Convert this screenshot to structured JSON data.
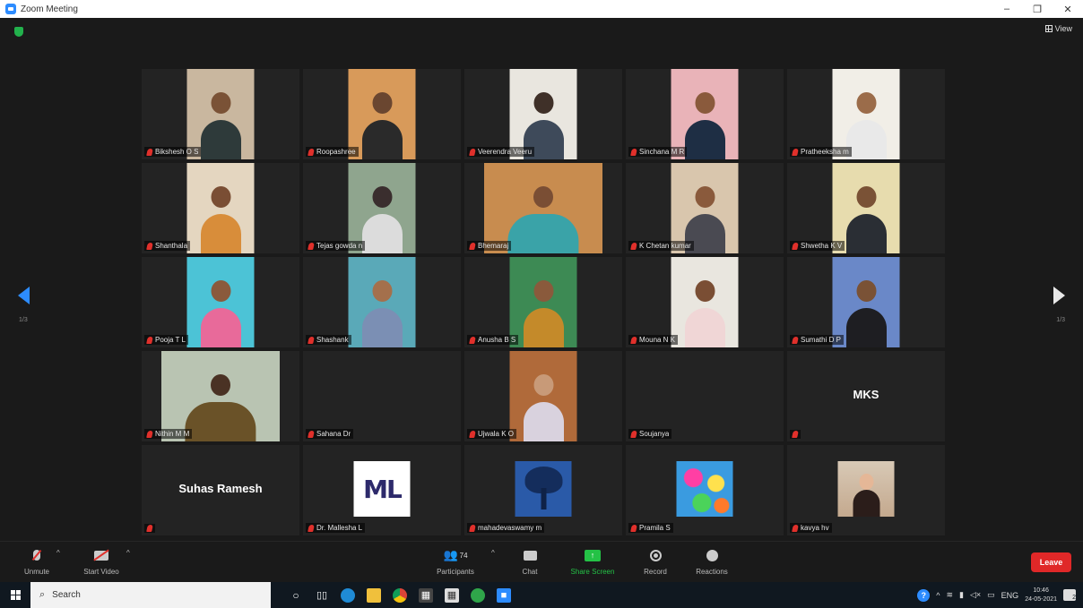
{
  "window": {
    "title": "Zoom Meeting",
    "minimize": "–",
    "maximize": "❐",
    "close": "✕"
  },
  "meeting": {
    "view_label": "View",
    "page_left": "1/3",
    "page_right": "1/3"
  },
  "tiles": [
    {
      "name": "Bikshesh O S",
      "kind": "video",
      "bg": "#c9b79f",
      "skin": "#7a5236",
      "shirt": "#2e3a3a"
    },
    {
      "name": "Roopashree",
      "kind": "video",
      "bg": "#d89a5a",
      "skin": "#6a4630",
      "shirt": "#2a2a2a"
    },
    {
      "name": "Veerendra Veeru",
      "kind": "video",
      "bg": "#e9e6df",
      "skin": "#3f3028",
      "shirt": "#3e4a5a"
    },
    {
      "name": "Sinchana M R",
      "kind": "video",
      "bg": "#e9b3b8",
      "skin": "#8a5a3c",
      "shirt": "#1e2e44"
    },
    {
      "name": "Pratheeksha m",
      "kind": "video",
      "bg": "#f1eee7",
      "skin": "#9b6c4a",
      "shirt": "#e9e9e9"
    },
    {
      "name": "Shanthala",
      "kind": "video",
      "bg": "#e4d6c0",
      "skin": "#7a4e34",
      "shirt": "#d88d3a"
    },
    {
      "name": "Tejas gowda n",
      "kind": "video",
      "bg": "#8fa58e",
      "skin": "#3a2e2e",
      "shirt": "#dcdcdc"
    },
    {
      "name": "Bhemaraj",
      "kind": "video-wide",
      "bg": "#c88c4f",
      "skin": "#7a4e34",
      "shirt": "#3aa3a8"
    },
    {
      "name": "K Chetan kumar",
      "kind": "video",
      "bg": "#d9c6ad",
      "skin": "#8a5a3c",
      "shirt": "#4a4a52"
    },
    {
      "name": "Shwetha K V",
      "kind": "video",
      "bg": "#e7dcae",
      "skin": "#7a5236",
      "shirt": "#2a2e34"
    },
    {
      "name": "Pooja T L",
      "kind": "video",
      "bg": "#4cc3d6",
      "skin": "#8a5a3c",
      "shirt": "#e86a9a"
    },
    {
      "name": "Shashank",
      "kind": "video",
      "bg": "#5aa9b8",
      "skin": "#a4704c",
      "shirt": "#7b8fb4"
    },
    {
      "name": "Anusha B S",
      "kind": "video",
      "bg": "#3d8a54",
      "skin": "#8a5a3c",
      "shirt": "#c48a2a"
    },
    {
      "name": "Mouna N K",
      "kind": "video",
      "bg": "#e9e6df",
      "skin": "#7a4e34",
      "shirt": "#f0d6d6"
    },
    {
      "name": "Sumathi D P",
      "kind": "video",
      "bg": "#6a88c8",
      "skin": "#7a5236",
      "shirt": "#1e1e22"
    },
    {
      "name": "Nithin M M",
      "kind": "video-wide",
      "bg": "#b9c4b2",
      "skin": "#4a3224",
      "shirt": "#6a5228"
    },
    {
      "name": "Sahana Dr",
      "kind": "empty"
    },
    {
      "name": "Ujwala K O",
      "kind": "video",
      "bg": "#b06a3a",
      "skin": "#c89a78",
      "shirt": "#d9d2de"
    },
    {
      "name": "Soujanya",
      "kind": "empty"
    },
    {
      "name": "",
      "kind": "text",
      "display": "MKS"
    },
    {
      "name": "",
      "kind": "text",
      "display": "Suhas Ramesh"
    },
    {
      "name": "Dr. Mallesha L",
      "kind": "logo-ml",
      "logo_text": "ML"
    },
    {
      "name": "mahadevaswamy m",
      "kind": "logo-tree"
    },
    {
      "name": "Pramila S",
      "kind": "flower"
    },
    {
      "name": "kavya hv",
      "kind": "kavya"
    }
  ],
  "toolbar": {
    "unmute": "Unmute",
    "start_video": "Start Video",
    "participants": "Participants",
    "participant_count": "74",
    "chat": "Chat",
    "share_screen": "Share Screen",
    "record": "Record",
    "reactions": "Reactions",
    "leave": "Leave"
  },
  "taskbar": {
    "search": "Search",
    "lang": "ENG",
    "time": "10:46",
    "date": "24-05-2021",
    "notif_count": "2"
  },
  "colors": {
    "accent": "#2d8cff",
    "leave": "#e02828",
    "share": "#24c246",
    "muted_mic": "#e0302b"
  }
}
